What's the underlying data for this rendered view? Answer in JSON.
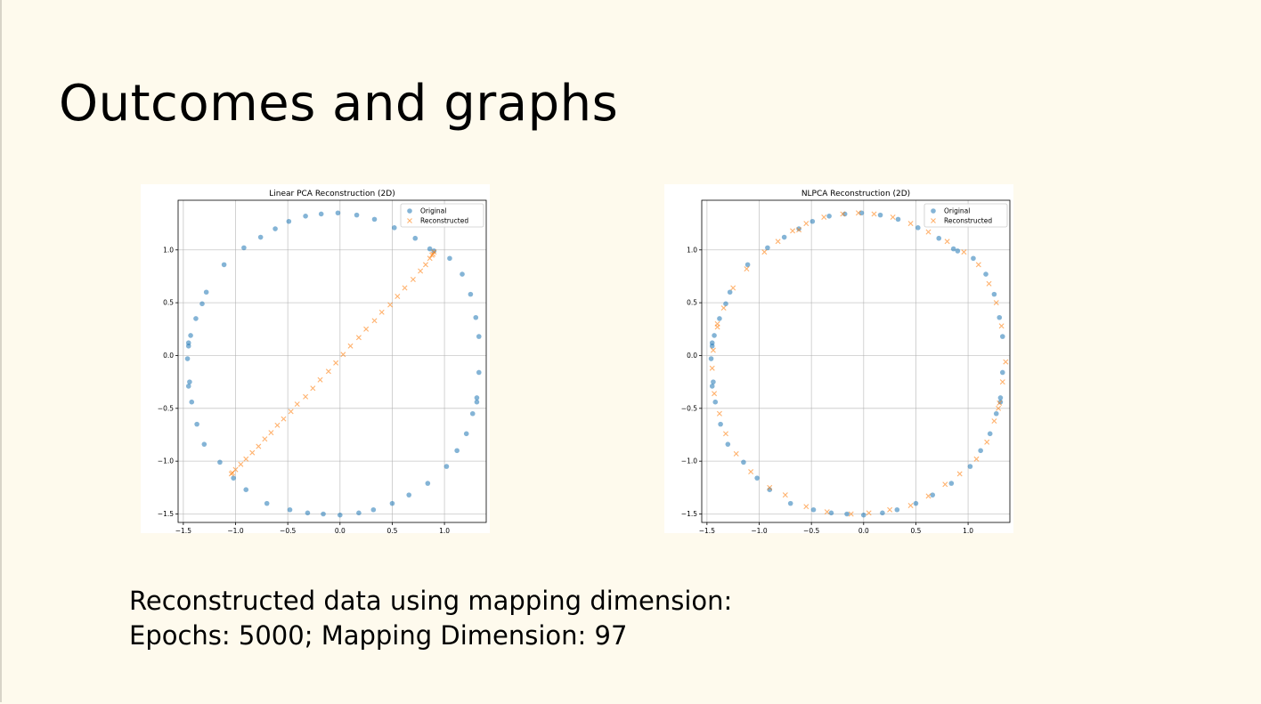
{
  "slide": {
    "title": "Outcomes and graphs",
    "caption_line1": "Reconstructed data using mapping dimension:",
    "caption_line2": "Epochs: 5000; Mapping Dimension: 97"
  },
  "chart_data": [
    {
      "type": "scatter",
      "title": "Linear PCA Reconstruction (2D)",
      "xlabel": "",
      "ylabel": "",
      "xlim": [
        -1.55,
        1.4
      ],
      "ylim": [
        -1.58,
        1.47
      ],
      "xticks": [
        -1.5,
        -1.0,
        -0.5,
        0.0,
        0.5,
        1.0
      ],
      "yticks": [
        -1.5,
        -1.0,
        -0.5,
        0.0,
        0.5,
        1.0
      ],
      "grid": true,
      "legend": "top-right",
      "series": [
        {
          "name": "Original",
          "marker": "circle",
          "color": "#1f77b4",
          "points": [
            [
              -0.02,
              1.35
            ],
            [
              -0.18,
              1.34
            ],
            [
              -0.33,
              1.32
            ],
            [
              -0.49,
              1.27
            ],
            [
              -0.62,
              1.2
            ],
            [
              -0.76,
              1.12
            ],
            [
              -0.92,
              1.02
            ],
            [
              -1.11,
              0.86
            ],
            [
              -1.28,
              0.6
            ],
            [
              -1.32,
              0.49
            ],
            [
              -1.38,
              0.35
            ],
            [
              -1.43,
              0.19
            ],
            [
              -1.45,
              0.12
            ],
            [
              -1.46,
              -0.03
            ],
            [
              -1.45,
              -0.29
            ],
            [
              -1.42,
              -0.44
            ],
            [
              -1.37,
              -0.65
            ],
            [
              -1.3,
              -0.84
            ],
            [
              -1.15,
              -1.01
            ],
            [
              -1.02,
              -1.16
            ],
            [
              -0.9,
              -1.27
            ],
            [
              -0.7,
              -1.4
            ],
            [
              -0.48,
              -1.46
            ],
            [
              -0.31,
              -1.49
            ],
            [
              -0.16,
              -1.5
            ],
            [
              0.0,
              -1.51
            ],
            [
              0.18,
              -1.49
            ],
            [
              0.32,
              -1.46
            ],
            [
              0.5,
              -1.4
            ],
            [
              0.66,
              -1.32
            ],
            [
              0.84,
              -1.21
            ],
            [
              1.02,
              -1.05
            ],
            [
              1.12,
              -0.9
            ],
            [
              1.21,
              -0.74
            ],
            [
              1.27,
              -0.55
            ],
            [
              1.31,
              -0.4
            ],
            [
              1.33,
              -0.16
            ],
            [
              1.33,
              0.18
            ],
            [
              1.3,
              0.36
            ],
            [
              1.25,
              0.58
            ],
            [
              1.17,
              0.77
            ],
            [
              1.05,
              0.92
            ],
            [
              0.9,
              0.99
            ],
            [
              0.72,
              1.11
            ],
            [
              0.52,
              1.21
            ],
            [
              0.33,
              1.29
            ],
            [
              0.16,
              1.33
            ],
            [
              -1.44,
              -0.25
            ],
            [
              -1.45,
              0.09
            ],
            [
              1.31,
              -0.44
            ],
            [
              0.86,
              1.01
            ]
          ]
        },
        {
          "name": "Reconstructed",
          "marker": "x",
          "color": "#ff7f0e",
          "points": [
            [
              -1.03,
              -1.11
            ],
            [
              -1.0,
              -1.08
            ],
            [
              -0.95,
              -1.03
            ],
            [
              -0.9,
              -0.98
            ],
            [
              -0.84,
              -0.92
            ],
            [
              -0.78,
              -0.86
            ],
            [
              -0.72,
              -0.79
            ],
            [
              -0.66,
              -0.73
            ],
            [
              -0.6,
              -0.66
            ],
            [
              -0.54,
              -0.6
            ],
            [
              -0.47,
              -0.53
            ],
            [
              -0.41,
              -0.46
            ],
            [
              -0.33,
              -0.39
            ],
            [
              -0.26,
              -0.31
            ],
            [
              -0.19,
              -0.23
            ],
            [
              -0.11,
              -0.15
            ],
            [
              -0.04,
              -0.07
            ],
            [
              0.03,
              0.01
            ],
            [
              0.1,
              0.09
            ],
            [
              0.18,
              0.17
            ],
            [
              0.25,
              0.25
            ],
            [
              0.33,
              0.33
            ],
            [
              0.4,
              0.41
            ],
            [
              0.48,
              0.48
            ],
            [
              0.55,
              0.56
            ],
            [
              0.62,
              0.64
            ],
            [
              0.7,
              0.72
            ],
            [
              0.77,
              0.8
            ],
            [
              0.82,
              0.86
            ],
            [
              0.86,
              0.92
            ],
            [
              0.89,
              0.96
            ],
            [
              0.9,
              0.98
            ],
            [
              -1.04,
              -1.12
            ],
            [
              0.88,
              0.95
            ]
          ]
        }
      ]
    },
    {
      "type": "scatter",
      "title": "NLPCA Reconstruction (2D)",
      "xlabel": "",
      "ylabel": "",
      "xlim": [
        -1.55,
        1.4
      ],
      "ylim": [
        -1.58,
        1.47
      ],
      "xticks": [
        -1.5,
        -1.0,
        -0.5,
        0.0,
        0.5,
        1.0
      ],
      "yticks": [
        -1.5,
        -1.0,
        -0.5,
        0.0,
        0.5,
        1.0
      ],
      "grid": true,
      "legend": "top-right",
      "series": [
        {
          "name": "Original",
          "marker": "circle",
          "color": "#1f77b4",
          "points": [
            [
              -0.02,
              1.35
            ],
            [
              -0.18,
              1.34
            ],
            [
              -0.33,
              1.32
            ],
            [
              -0.49,
              1.27
            ],
            [
              -0.62,
              1.2
            ],
            [
              -0.76,
              1.12
            ],
            [
              -0.92,
              1.02
            ],
            [
              -1.11,
              0.86
            ],
            [
              -1.28,
              0.6
            ],
            [
              -1.32,
              0.49
            ],
            [
              -1.38,
              0.35
            ],
            [
              -1.43,
              0.19
            ],
            [
              -1.45,
              0.12
            ],
            [
              -1.46,
              -0.03
            ],
            [
              -1.45,
              -0.29
            ],
            [
              -1.42,
              -0.44
            ],
            [
              -1.37,
              -0.65
            ],
            [
              -1.3,
              -0.84
            ],
            [
              -1.15,
              -1.01
            ],
            [
              -1.02,
              -1.16
            ],
            [
              -0.9,
              -1.27
            ],
            [
              -0.7,
              -1.4
            ],
            [
              -0.48,
              -1.46
            ],
            [
              -0.31,
              -1.49
            ],
            [
              -0.16,
              -1.5
            ],
            [
              0.0,
              -1.51
            ],
            [
              0.18,
              -1.49
            ],
            [
              0.32,
              -1.46
            ],
            [
              0.5,
              -1.4
            ],
            [
              0.66,
              -1.32
            ],
            [
              0.84,
              -1.21
            ],
            [
              1.02,
              -1.05
            ],
            [
              1.12,
              -0.9
            ],
            [
              1.21,
              -0.74
            ],
            [
              1.27,
              -0.55
            ],
            [
              1.31,
              -0.4
            ],
            [
              1.33,
              -0.16
            ],
            [
              1.33,
              0.18
            ],
            [
              1.3,
              0.36
            ],
            [
              1.25,
              0.58
            ],
            [
              1.17,
              0.77
            ],
            [
              1.05,
              0.92
            ],
            [
              0.9,
              0.99
            ],
            [
              0.72,
              1.11
            ],
            [
              0.52,
              1.21
            ],
            [
              0.33,
              1.29
            ],
            [
              0.16,
              1.33
            ],
            [
              -1.44,
              -0.25
            ],
            [
              -1.45,
              0.09
            ],
            [
              1.31,
              -0.44
            ],
            [
              0.86,
              1.01
            ]
          ]
        },
        {
          "name": "Reconstructed",
          "marker": "x",
          "color": "#ff7f0e",
          "points": [
            [
              -0.05,
              1.35
            ],
            [
              -0.2,
              1.34
            ],
            [
              -0.38,
              1.31
            ],
            [
              -0.55,
              1.25
            ],
            [
              -0.68,
              1.18
            ],
            [
              -0.82,
              1.08
            ],
            [
              -0.95,
              0.98
            ],
            [
              -1.12,
              0.82
            ],
            [
              -1.25,
              0.64
            ],
            [
              -1.34,
              0.45
            ],
            [
              -1.4,
              0.27
            ],
            [
              -1.44,
              0.05
            ],
            [
              -1.45,
              -0.12
            ],
            [
              -1.43,
              -0.36
            ],
            [
              -1.38,
              -0.55
            ],
            [
              -1.32,
              -0.74
            ],
            [
              -1.22,
              -0.93
            ],
            [
              -1.08,
              -1.1
            ],
            [
              -0.9,
              -1.25
            ],
            [
              -0.75,
              -1.32
            ],
            [
              -0.55,
              -1.43
            ],
            [
              -0.35,
              -1.48
            ],
            [
              -0.12,
              -1.5
            ],
            [
              0.05,
              -1.49
            ],
            [
              0.25,
              -1.46
            ],
            [
              0.45,
              -1.42
            ],
            [
              0.62,
              -1.33
            ],
            [
              0.78,
              -1.22
            ],
            [
              0.92,
              -1.12
            ],
            [
              1.08,
              -0.98
            ],
            [
              1.18,
              -0.82
            ],
            [
              1.25,
              -0.62
            ],
            [
              1.3,
              -0.45
            ],
            [
              1.33,
              -0.25
            ],
            [
              1.36,
              -0.06
            ],
            [
              1.32,
              0.28
            ],
            [
              1.27,
              0.5
            ],
            [
              1.2,
              0.68
            ],
            [
              1.1,
              0.86
            ],
            [
              0.96,
              0.98
            ],
            [
              0.8,
              1.08
            ],
            [
              0.62,
              1.17
            ],
            [
              0.45,
              1.25
            ],
            [
              0.28,
              1.31
            ],
            [
              0.1,
              1.34
            ],
            [
              -0.62,
              1.19
            ],
            [
              -1.4,
              0.3
            ],
            [
              1.29,
              -0.5
            ]
          ]
        }
      ]
    }
  ]
}
